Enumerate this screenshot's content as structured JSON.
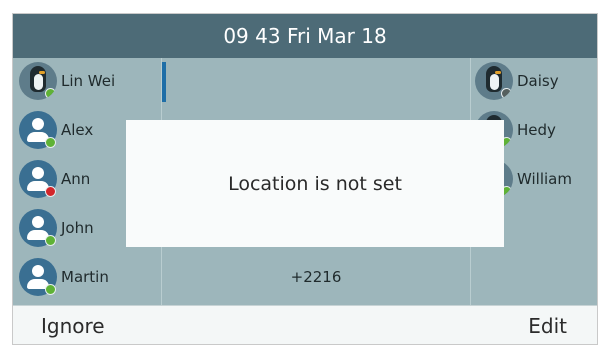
{
  "header": {
    "datetime": "09 43 Fri Mar 18"
  },
  "left_contacts": [
    {
      "name": "Lin Wei",
      "avatar": "penguin-photo",
      "status": "online"
    },
    {
      "name": "Alex",
      "avatar": "generic-person-icon",
      "status": "online"
    },
    {
      "name": "Ann",
      "avatar": "generic-person-icon",
      "status": "busy"
    },
    {
      "name": "John",
      "avatar": "generic-person-icon",
      "status": "online"
    },
    {
      "name": "Martin",
      "avatar": "generic-person-icon",
      "status": "online"
    }
  ],
  "right_contacts": [
    {
      "name": "Daisy",
      "avatar": "penguin-photo",
      "status": "offline"
    },
    {
      "name": "Hedy",
      "avatar": "penguin-photo",
      "status": "online"
    },
    {
      "name": "William",
      "avatar": "penguin-photo",
      "status": "online"
    }
  ],
  "middle": {
    "dialed_number": "+2216"
  },
  "dialog": {
    "message": "Location is not set"
  },
  "softkeys": {
    "left": "Ignore",
    "right": "Edit"
  },
  "colors": {
    "header_bg": "#4d6b77",
    "content_bg": "#9db6bb",
    "avatar_blue": "#3a6f92",
    "status_online": "#5fb236",
    "status_busy": "#d2262b",
    "status_offline": "#55605f",
    "cursor": "#1e6ea7"
  }
}
